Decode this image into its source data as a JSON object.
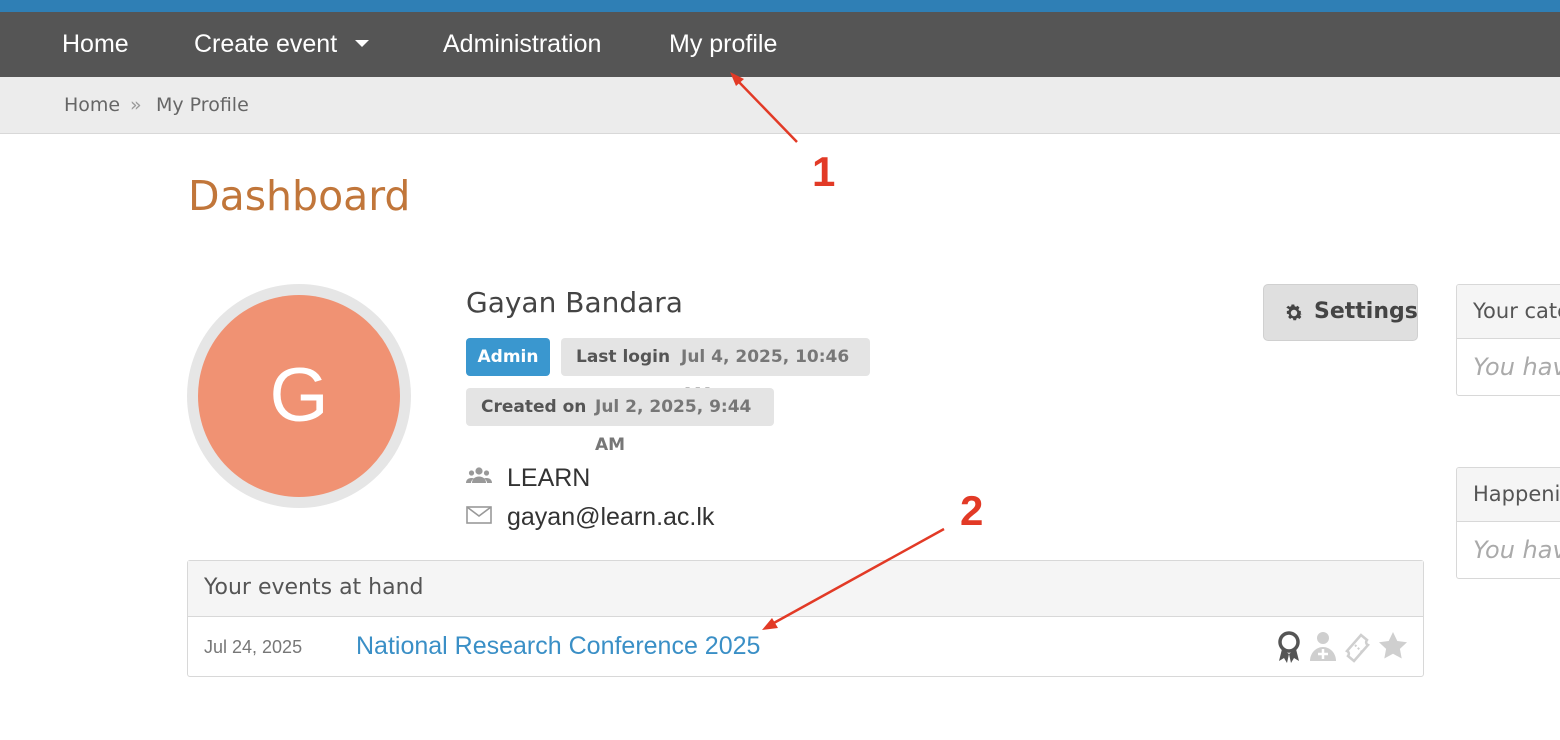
{
  "navbar": {
    "items": [
      {
        "label": "Home"
      },
      {
        "label": "Create event"
      },
      {
        "label": "Administration"
      },
      {
        "label": "My profile"
      }
    ]
  },
  "breadcrumb": {
    "home": "Home",
    "separator": "»",
    "current": "My Profile"
  },
  "page": {
    "title": "Dashboard"
  },
  "profile": {
    "avatar_letter": "G",
    "name": "Gayan Bandara",
    "role_badge": "Admin",
    "last_login_label": "Last login",
    "last_login_value": "Jul 4, 2025, 10:46 AM",
    "created_label": "Created on",
    "created_value": "Jul 2, 2025, 9:44 AM",
    "affiliation": "LEARN",
    "email": "gayan@learn.ac.lk",
    "settings_label": "Settings"
  },
  "events": {
    "header": "Your events at hand",
    "items": [
      {
        "date": "Jul 24, 2025",
        "title": "National Research Conference 2025"
      }
    ]
  },
  "side": {
    "categories_header": "Your cate",
    "categories_body": "You hav",
    "happening_header": "Happenin",
    "happening_body": "You hav"
  },
  "annotations": {
    "marker1": "1",
    "marker2": "2"
  },
  "colors": {
    "accent_stripe": "#2f7fb5",
    "navbar": "#555555",
    "title": "#c1763a",
    "avatar": "#f09273",
    "admin_badge": "#3a97cf",
    "link": "#3a8fc6",
    "annotation": "#e23a26"
  }
}
